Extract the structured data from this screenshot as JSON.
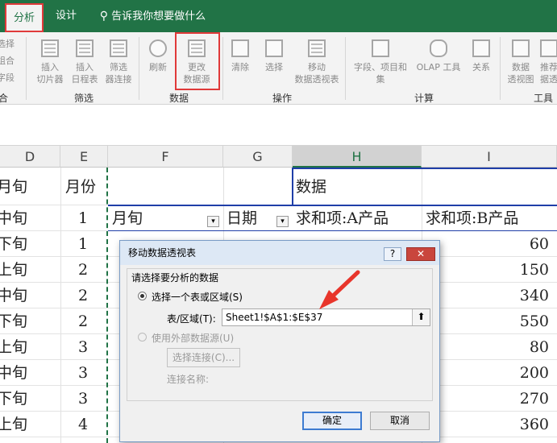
{
  "tabs": {
    "analyze": "分析",
    "design": "设计",
    "tell_me": "告诉我你想要做什么"
  },
  "ribbon": {
    "left_cut": [
      "选择",
      "组合",
      "字段"
    ],
    "left_cut_group": "合",
    "buttons": {
      "insert_slicer": "插入\n切片器",
      "insert_timeline": "插入\n日程表",
      "filter_connections": "筛选\n器连接",
      "refresh": "刷新",
      "change_source": "更改\n数据源",
      "clear": "清除",
      "select": "选择",
      "move_pivot": "移动\n数据透视表",
      "fields_items": "字段、项目和\n集",
      "olap_tools": "OLAP 工具",
      "relationships": "关系",
      "pivot_chart": "数据\n透视图",
      "recommended": "推荐\n据透"
    },
    "groups": {
      "filter": "筛选",
      "data": "数据",
      "actions": "操作",
      "calculations": "计算",
      "tools": "工具"
    }
  },
  "sheet": {
    "columns": [
      "D",
      "E",
      "F",
      "G",
      "H",
      "I"
    ],
    "col_d": [
      "月旬",
      "中旬",
      "下旬",
      "上旬",
      "中旬",
      "下旬",
      "上旬",
      "中旬",
      "下旬",
      "上旬"
    ],
    "col_e": [
      "月份",
      "1",
      "1",
      "2",
      "2",
      "2",
      "3",
      "3",
      "3",
      "4"
    ],
    "pivot_header": "数据",
    "row_label_1": "月旬",
    "row_label_2": "日期",
    "sum_a": "求和项:A产品",
    "sum_b": "求和项:B产品",
    "col_i_values": [
      "60",
      "150",
      "340",
      "550",
      "80",
      "200",
      "270",
      "360"
    ]
  },
  "dialog": {
    "title": "移动数据透视表",
    "help": "?",
    "close": "✕",
    "prompt": "请选择要分析的数据",
    "option_range": "选择一个表或区域(S)",
    "range_label": "表/区域(T):",
    "range_value": "Sheet1!$A$1:$E$37",
    "collapse_icon": "⬆",
    "option_external": "使用外部数据源(U)",
    "choose_connection": "选择连接(C)...",
    "connection_name": "连接名称:",
    "ok": "确定",
    "cancel": "取消"
  }
}
